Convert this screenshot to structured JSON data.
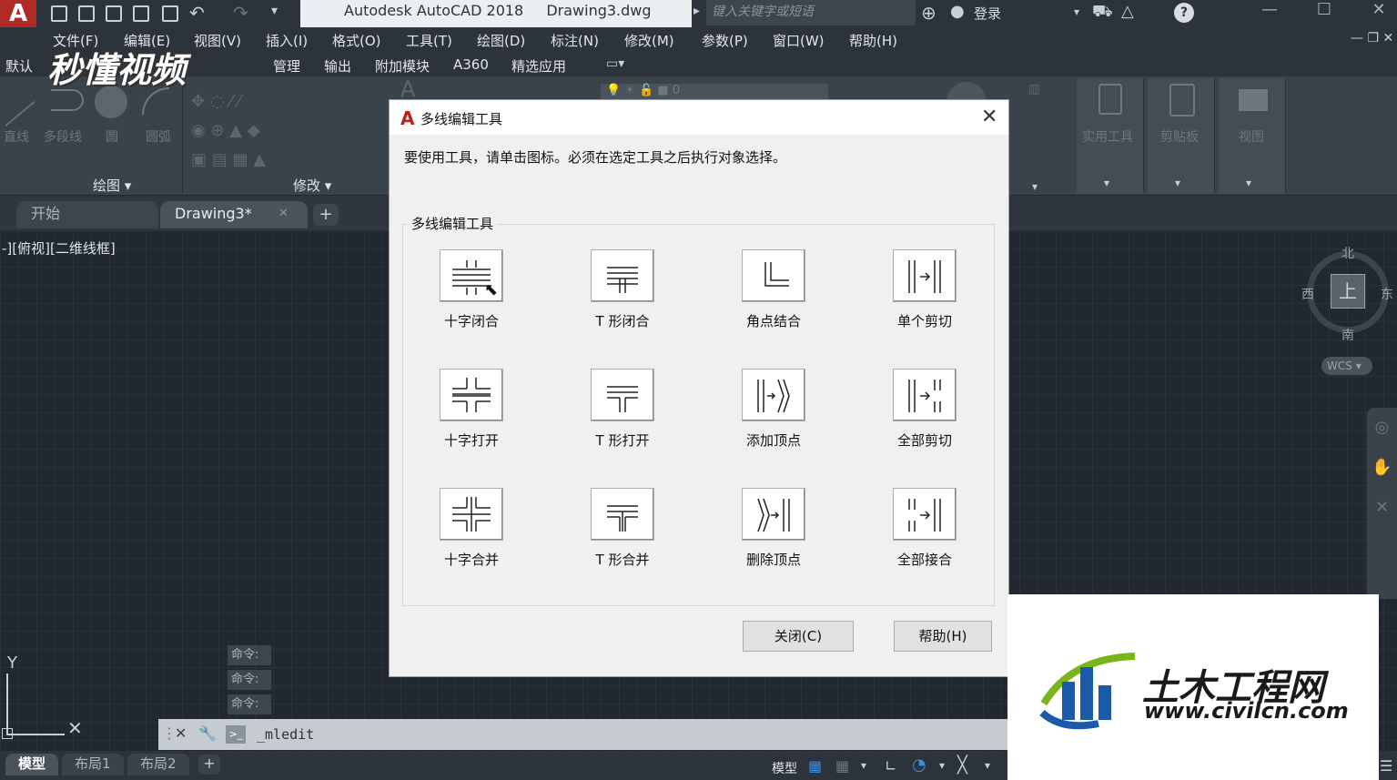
{
  "titlebar": {
    "app_name": "Autodesk AutoCAD 2018",
    "doc_name": "Drawing3.dwg",
    "search_placeholder": "键入关键字或短语",
    "login": "登录"
  },
  "menu": [
    "文件(F)",
    "编辑(E)",
    "视图(V)",
    "插入(I)",
    "格式(O)",
    "工具(T)",
    "绘图(D)",
    "标注(N)",
    "修改(M)",
    "参数(P)",
    "窗口(W)",
    "帮助(H)"
  ],
  "ribbon_tabs": [
    "默认",
    "管理",
    "输出",
    "附加模块",
    "A360",
    "精选应用"
  ],
  "ribbon": {
    "draw_buttons": [
      "直线",
      "多段线",
      "圆",
      "圆弧"
    ],
    "panel_draw": "绘图",
    "panel_modify": "修改",
    "right_panels": [
      "实用工具",
      "剪贴板",
      "视图"
    ],
    "layer_value": "0"
  },
  "doc_tabs": {
    "start": "开始",
    "drawing": "Drawing3*"
  },
  "viewport_label": "-][俯视][二维线框]",
  "viewcube": {
    "top": "上",
    "north": "北",
    "south": "南",
    "east": "东",
    "west": "西",
    "wcs": "WCS"
  },
  "command": {
    "history": [
      "命令:",
      "命令:",
      "命令:"
    ],
    "current": "_mledit"
  },
  "layout_tabs": [
    "模型",
    "布局1",
    "布局2"
  ],
  "status": {
    "model": "模型"
  },
  "dialog": {
    "title": "多线编辑工具",
    "instruction": "要使用工具，请单击图标。必须在选定工具之后执行对象选择。",
    "group_label": "多线编辑工具",
    "tools": [
      {
        "label": "十字闭合",
        "icon": "closed-cross-icon"
      },
      {
        "label": "T 形闭合",
        "icon": "closed-tee-icon"
      },
      {
        "label": "角点结合",
        "icon": "corner-joint-icon"
      },
      {
        "label": "单个剪切",
        "icon": "cut-single-icon"
      },
      {
        "label": "十字打开",
        "icon": "open-cross-icon"
      },
      {
        "label": "T 形打开",
        "icon": "open-tee-icon"
      },
      {
        "label": "添加顶点",
        "icon": "add-vertex-icon"
      },
      {
        "label": "全部剪切",
        "icon": "cut-all-icon"
      },
      {
        "label": "十字合并",
        "icon": "merged-cross-icon"
      },
      {
        "label": "T 形合并",
        "icon": "merged-tee-icon"
      },
      {
        "label": "删除顶点",
        "icon": "delete-vertex-icon"
      },
      {
        "label": "全部接合",
        "icon": "weld-all-icon"
      }
    ],
    "close_button": "关闭(C)",
    "help_button": "帮助(H)"
  },
  "watermarks": {
    "top_left": "秒懂视频",
    "brand_cn": "土木工程网",
    "brand_url": "www.civilcn.com"
  },
  "colors": {
    "autocad_red": "#c0201a",
    "canvas": "#212830",
    "civil_blue": "#1a5aa8",
    "civil_green": "#7ab51d"
  }
}
